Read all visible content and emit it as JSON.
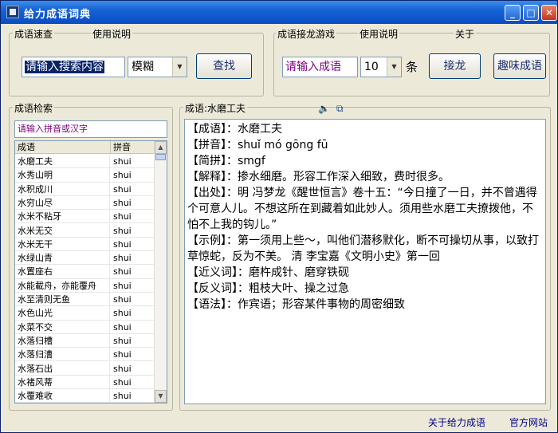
{
  "window": {
    "title": "给力成语词典",
    "minimize": "_",
    "maximize": "□",
    "close": "✕"
  },
  "quick_search": {
    "group_label": "成语速查",
    "help_label": "使用说明",
    "input_value": "请输入搜索内容",
    "mode_value": "模糊",
    "search_button": "查找"
  },
  "chain_game": {
    "group_label": "成语接龙游戏",
    "help_label": "使用说明",
    "about_label": "关于",
    "input_value": "请输入成语",
    "count_value": "10",
    "count_unit": "条",
    "chain_button": "接龙",
    "fun_button": "趣味成语"
  },
  "idiom_search": {
    "group_label": "成语检索",
    "input_value": "请输入拼音或汉字",
    "col_idiom": "成语",
    "col_pinyin": "拼音",
    "rows": [
      {
        "idiom": "水磨工夫",
        "pinyin": "shui"
      },
      {
        "idiom": "水秀山明",
        "pinyin": "shui"
      },
      {
        "idiom": "水积成川",
        "pinyin": "shui"
      },
      {
        "idiom": "水穷山尽",
        "pinyin": "shui"
      },
      {
        "idiom": "水米不粘牙",
        "pinyin": "shui"
      },
      {
        "idiom": "水米无交",
        "pinyin": "shui"
      },
      {
        "idiom": "水米无干",
        "pinyin": "shui"
      },
      {
        "idiom": "水绿山青",
        "pinyin": "shui"
      },
      {
        "idiom": "水置座右",
        "pinyin": "shui"
      },
      {
        "idiom": "水能載舟，亦能覆舟",
        "pinyin": "shui"
      },
      {
        "idiom": "水至清则无鱼",
        "pinyin": "shui"
      },
      {
        "idiom": "水色山光",
        "pinyin": "shui"
      },
      {
        "idiom": "水菜不交",
        "pinyin": "shui"
      },
      {
        "idiom": "水落归槽",
        "pinyin": "shui"
      },
      {
        "idiom": "水落归漕",
        "pinyin": "shui"
      },
      {
        "idiom": "水落石出",
        "pinyin": "shui"
      },
      {
        "idiom": "水褚风蒂",
        "pinyin": "shui"
      },
      {
        "idiom": "水覆难收",
        "pinyin": "shui"
      }
    ]
  },
  "detail": {
    "label": "成语:水磨工夫",
    "speaker_icon": "speaker-icon",
    "copy_icon": "copy-icon",
    "entries": [
      "【成语】：水磨工夫",
      "【拼音】：shuǐ mó gōng fū",
      "【简拼】：smgf",
      "【解释】：掺水细磨。形容工作深入细致，费时很多。",
      "【出处】：明 冯梦龙《醒世恒言》卷十五：“今日撞了一日，并不曾遇得个可意人儿。不想这所在到藏着如此妙人。须用些水磨工夫撩拨他，不怕不上我的钩儿。”",
      "【示例】：第一须用上些～，叫他们潜移默化，断不可操切从事，以致打草惊蛇，反为不美。 清 李宝嘉《文明小史》第一回",
      "【近义词】：磨杵成针、磨穿铁砚",
      "【反义词】：粗枝大叶、操之过急",
      "【语法】：作宾语；形容某件事物的周密细致"
    ]
  },
  "footer": {
    "about_link": "关于给力成语",
    "site_link": "官方网站"
  },
  "colors": {
    "titlebar": "#0a4cc4",
    "dialog_bg": "#ece9d8",
    "highlight": "#0a246a",
    "purple_text": "#800080"
  }
}
